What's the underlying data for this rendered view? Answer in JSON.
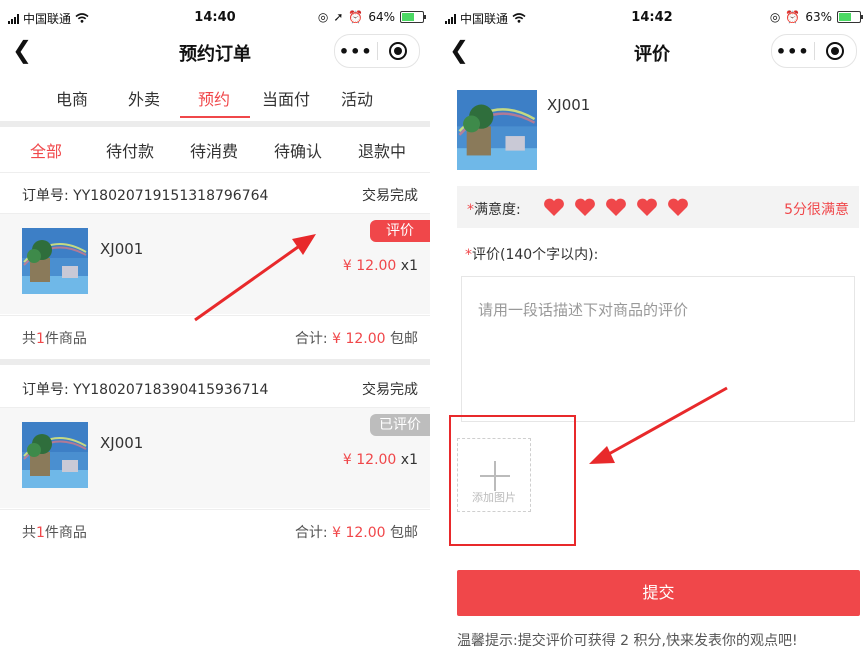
{
  "colors": {
    "accent": "#f0474a",
    "annotation": "#e8292b"
  },
  "left_screen": {
    "status": {
      "carrier": "中国联通",
      "time": "14:40",
      "battery": "64%"
    },
    "title": "预约订单",
    "top_tabs": [
      "电商",
      "外卖",
      "预约",
      "当面付",
      "活动"
    ],
    "active_top_tab": 2,
    "sub_tabs": [
      "全部",
      "待付款",
      "待消费",
      "待确认",
      "退款中"
    ],
    "active_sub_tab": 0,
    "orders": [
      {
        "number": "订单号: YY18020719151318796764",
        "status": "交易完成",
        "product": "XJ001",
        "price": "¥ 12.00",
        "qty": "x1",
        "tag": "评价",
        "count_prefix": "共",
        "count": "1",
        "count_suffix": "件商品",
        "total_label": "合计:",
        "total": "¥ 12.00",
        "shipping": "包邮"
      },
      {
        "number": "订单号: YY18020718390415936714",
        "status": "交易完成",
        "product": "XJ001",
        "price": "¥ 12.00",
        "qty": "x1",
        "tag": "已评价",
        "count_prefix": "共",
        "count": "1",
        "count_suffix": "件商品",
        "total_label": "合计:",
        "total": "¥ 12.00",
        "shipping": "包邮"
      }
    ]
  },
  "right_screen": {
    "status": {
      "carrier": "中国联通",
      "time": "14:42",
      "battery": "63%"
    },
    "title": "评价",
    "product": "XJ001",
    "satisfaction_label": "满意度:",
    "rating": 5,
    "rating_text": "5分很满意",
    "review_label": "评价(140个字以内):",
    "review_placeholder": "请用一段话描述下对商品的评价",
    "add_image_label": "添加图片",
    "submit_label": "提交",
    "tip": "温馨提示:提交评价可获得 2 积分,快来发表你的观点吧!"
  }
}
